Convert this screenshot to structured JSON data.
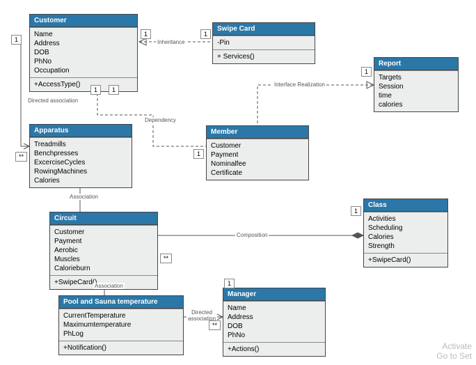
{
  "classes": {
    "customer": {
      "title": "Customer",
      "attrs": [
        "Name",
        "Address",
        "DOB",
        "PhNo",
        "Occupation"
      ],
      "ops": [
        "+AccessType()"
      ]
    },
    "swipe": {
      "title": "Swipe Card",
      "attrs": [
        "-Pin"
      ],
      "ops": [
        "+ Services()"
      ]
    },
    "report": {
      "title": "Report",
      "attrs": [
        "Targets",
        "Session",
        "time",
        "calories"
      ]
    },
    "apparatus": {
      "title": "Apparatus",
      "attrs": [
        "Treadmills",
        "Benchpresses",
        "ExcerciseCycles",
        "RowingMachines",
        "Calories"
      ]
    },
    "member": {
      "title": "Member",
      "attrs": [
        "Customer",
        "Payment",
        "Nominalfee",
        "Certificate"
      ]
    },
    "classCls": {
      "title": "Class",
      "attrs": [
        "Activities",
        "Scheduling",
        "Calories",
        "Strength"
      ],
      "ops": [
        "+SwipeCard()"
      ]
    },
    "circuit": {
      "title": "Circuit",
      "attrs": [
        "Customer",
        "Payment",
        "Aerobic",
        "Muscles",
        "Calorieburn"
      ],
      "ops": [
        "+SwipeCard()"
      ]
    },
    "pool": {
      "title": "Pool and Sauna temperature",
      "attrs": [
        "CurrentTemperature",
        "Maximumtemperature",
        "PhLog"
      ],
      "ops": [
        "+Notification()"
      ]
    },
    "manager": {
      "title": "Manager",
      "attrs": [
        "Name",
        "Address",
        "DOB",
        "PhNo"
      ],
      "ops": [
        "+Actions()"
      ]
    }
  },
  "labels": {
    "inheritance": "Inheritance",
    "interfaceRealization": "Interface Realization",
    "directedAssoc": "Directed association",
    "dependency": "Dependency",
    "association": "Association",
    "composition": "Composition",
    "directedAssoc2": "Directed\nassociation"
  },
  "mult": {
    "one": "1",
    "many": "**"
  },
  "watermark": {
    "l1": "Activate",
    "l2": "Go to Set"
  }
}
